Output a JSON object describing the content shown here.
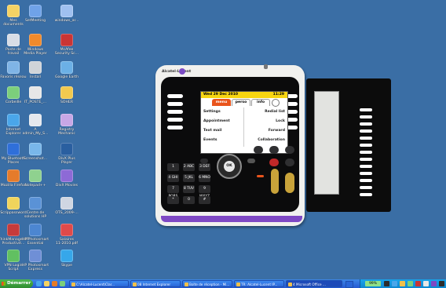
{
  "desktop": {
    "icons": [
      {
        "label": "Mes\ndocuments",
        "color": "#f4d264"
      },
      {
        "label": "SetMeeting",
        "color": "#6fa2e8"
      },
      {
        "label": "windows_ar...",
        "color": "#9fc0f0"
      },
      {
        "label": "Poste de\ntravail",
        "color": "#d8dde6"
      },
      {
        "label": "Windows\nMedia Player",
        "color": "#f08a2c"
      },
      {
        "label": "McAfee\nSecurity Sc...",
        "color": "#c93535"
      },
      {
        "label": "Favoris réseau",
        "color": "#7fb4e6"
      },
      {
        "label": "Install",
        "color": "#d0d4d8"
      },
      {
        "label": "Google Earth",
        "color": "#6bb0e6"
      },
      {
        "label": "Corbeille",
        "color": "#7ccf7c"
      },
      {
        "label": "IT_POSTE_...",
        "color": "#e7e7e7"
      },
      {
        "label": "SOHER",
        "color": "#f2c94f"
      },
      {
        "label": "Internet\nExplorer",
        "color": "#4aa6ea"
      },
      {
        "label": "A\nadmin_My_S...",
        "color": "#e5e8ee"
      },
      {
        "label": "Registry\nMechanic",
        "color": "#c8a7e6"
      },
      {
        "label": "My Bluetooth\nPlaces",
        "color": "#2f6fd9"
      },
      {
        "label": "Screenshot...",
        "color": "#79b7ea"
      },
      {
        "label": "DivX Plus\nPlayer",
        "color": "#2a5fa0"
      },
      {
        "label": "Mozilla Firefox",
        "color": "#e57b2b"
      },
      {
        "label": "Notepad++",
        "color": "#8fd18f"
      },
      {
        "label": "DivX Movies",
        "color": "#8d6ad6"
      },
      {
        "label": "Scrippassword",
        "color": "#f0d45c"
      },
      {
        "label": "Centre de\nsolutions HP",
        "color": "#5a92d6"
      },
      {
        "label": "OTS_2009-...",
        "color": "#cfd6e2"
      },
      {
        "label": "ThinkManage HP\nProductivit...",
        "color": "#c63b3b"
      },
      {
        "label": "HP Photosmart\nEssential",
        "color": "#4c86d1"
      },
      {
        "label": "Salaires\n11-2010.pdf",
        "color": "#e04a4a"
      },
      {
        "label": "VPN Login\nScript",
        "color": "#61c061"
      },
      {
        "label": "HP Photosmart\nExpress",
        "color": "#6f8fd6"
      },
      {
        "label": "Skype",
        "color": "#36a7ea"
      }
    ]
  },
  "phone": {
    "brand": "Alcatel-Lucent",
    "date": "Wed 29 Dec 2010",
    "time": "11:29",
    "tabs": [
      "menu",
      "perso",
      "info"
    ],
    "menu_left": [
      "Settings",
      "Appointment",
      "Text mail",
      "Events"
    ],
    "menu_right": [
      "Redial list",
      "Lock",
      "Forward",
      "Collaboration"
    ],
    "nav_ok": "OK",
    "dialpad": [
      "1",
      "2 ABC",
      "3 DEF",
      "4 GHI",
      "5 JKL",
      "6 MNO",
      "7 PQRS",
      "8 TUV",
      "9 WXYZ",
      "*",
      "0",
      "#"
    ]
  },
  "taskbar": {
    "start_label": "Démarrer",
    "tasks": [
      "C:\\Alcatel-Lucent\\Clar...",
      "08 Internet Explorer",
      "Boîte de réception - Mi...",
      "TR: Alcatel-Lucent IP...",
      "4 Microsoft Office ..."
    ],
    "battery": "99%"
  },
  "colors": {
    "desktop": "#3a6ea5",
    "accent_tab": "#e9541c",
    "date_bar": "#f7d511",
    "purple": "#7e48c4"
  }
}
